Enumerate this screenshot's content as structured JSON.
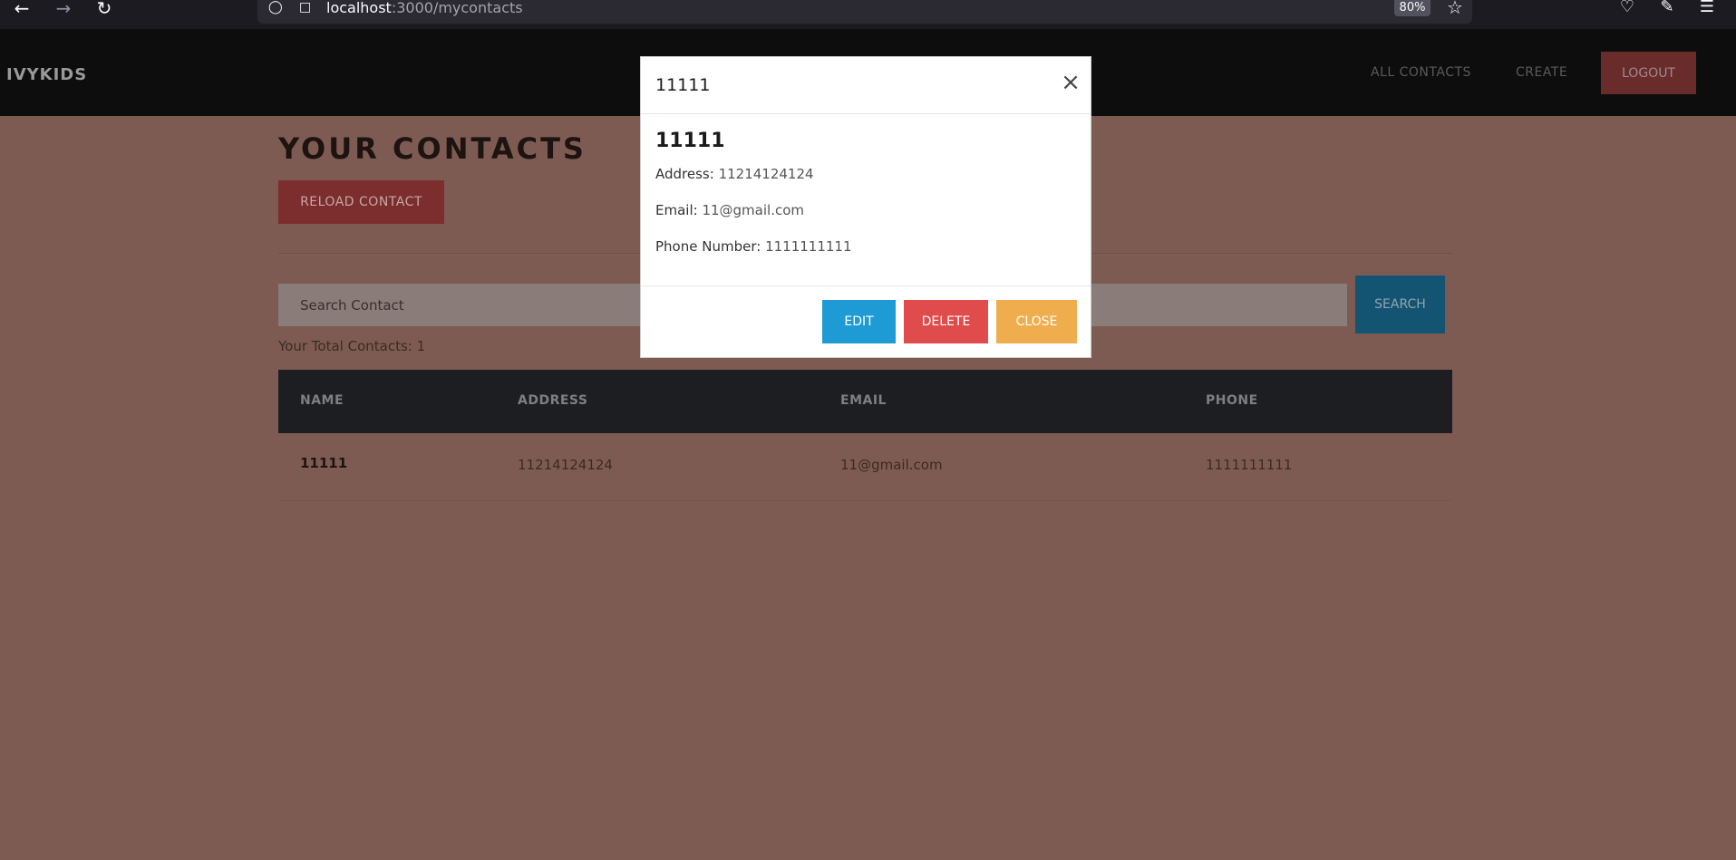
{
  "browser": {
    "url_host": "localhost",
    "url_path": ":3000/mycontacts",
    "zoom": "80%"
  },
  "navbar": {
    "brand": "IVYKIDS",
    "links": [
      "ALL CONTACTS",
      "CREATE"
    ],
    "logout_label": "LOGOUT"
  },
  "page": {
    "title": "YOUR CONTACTS",
    "reload_label": "RELOAD CONTACT",
    "search_placeholder": "Search Contact",
    "search_label": "SEARCH",
    "total_contacts_label": "Your Total Contacts: 1"
  },
  "table": {
    "headers": [
      "NAME",
      "ADDRESS",
      "EMAIL",
      "PHONE"
    ],
    "rows": [
      {
        "name": "11111",
        "address": "11214124124",
        "email": "11@gmail.com",
        "phone": "1111111111"
      }
    ]
  },
  "modal": {
    "title": "11111",
    "name": "11111",
    "address_label": "Address:",
    "address_value": "11214124124",
    "email_label": "Email:",
    "email_value": "11@gmail.com",
    "phone_label": "Phone Number:",
    "phone_value": "1111111111",
    "edit_label": "EDIT",
    "delete_label": "DELETE",
    "close_label": "CLOSE"
  },
  "colors": {
    "overlay_bg": "#7e5b52",
    "navbar_bg": "#0d0d0d",
    "edit_button": "#1e9bd4",
    "delete_button": "#e04b4b",
    "close_button": "#f0ad4e"
  }
}
